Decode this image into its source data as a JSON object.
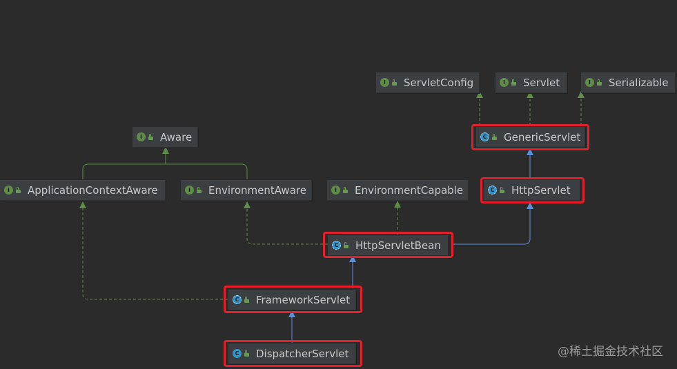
{
  "nodes": {
    "servlet_config": {
      "label": "ServletConfig",
      "kind": "interface",
      "badge": "I"
    },
    "servlet": {
      "label": "Servlet",
      "kind": "interface",
      "badge": "I"
    },
    "serializable": {
      "label": "Serializable",
      "kind": "interface",
      "badge": "I"
    },
    "generic_servlet": {
      "label": "GenericServlet",
      "kind": "abstract-class",
      "badge": "C"
    },
    "aware": {
      "label": "Aware",
      "kind": "interface",
      "badge": "I"
    },
    "application_context_aware": {
      "label": "ApplicationContextAware",
      "kind": "interface",
      "badge": "I"
    },
    "environment_aware": {
      "label": "EnvironmentAware",
      "kind": "interface",
      "badge": "I"
    },
    "environment_capable": {
      "label": "EnvironmentCapable",
      "kind": "interface",
      "badge": "I"
    },
    "http_servlet": {
      "label": "HttpServlet",
      "kind": "abstract-class",
      "badge": "C"
    },
    "http_servlet_bean": {
      "label": "HttpServletBean",
      "kind": "abstract-class",
      "badge": "C"
    },
    "framework_servlet": {
      "label": "FrameworkServlet",
      "kind": "abstract-class",
      "badge": "C"
    },
    "dispatcher_servlet": {
      "label": "DispatcherServlet",
      "kind": "class",
      "badge": "C"
    }
  },
  "edges": [
    {
      "from": "generic_servlet",
      "to": "servlet_config",
      "type": "implements"
    },
    {
      "from": "generic_servlet",
      "to": "servlet",
      "type": "implements"
    },
    {
      "from": "generic_servlet",
      "to": "serializable",
      "type": "implements"
    },
    {
      "from": "http_servlet",
      "to": "generic_servlet",
      "type": "extends"
    },
    {
      "from": "application_context_aware",
      "to": "aware",
      "type": "interface-extends"
    },
    {
      "from": "environment_aware",
      "to": "aware",
      "type": "interface-extends"
    },
    {
      "from": "http_servlet_bean",
      "to": "http_servlet",
      "type": "extends"
    },
    {
      "from": "http_servlet_bean",
      "to": "environment_capable",
      "type": "implements"
    },
    {
      "from": "http_servlet_bean",
      "to": "environment_aware",
      "type": "implements"
    },
    {
      "from": "framework_servlet",
      "to": "http_servlet_bean",
      "type": "extends"
    },
    {
      "from": "framework_servlet",
      "to": "application_context_aware",
      "type": "implements"
    },
    {
      "from": "dispatcher_servlet",
      "to": "framework_servlet",
      "type": "extends"
    }
  ],
  "highlighted": [
    "generic_servlet",
    "http_servlet",
    "http_servlet_bean",
    "framework_servlet",
    "dispatcher_servlet"
  ],
  "colors": {
    "background": "#2b2b2b",
    "node": "#3c3f41",
    "extends_edge": "#5b8fdc",
    "implements_edge": "#5f8c46",
    "highlight": "#e3202b",
    "interface_badge": "#5f8c46",
    "class_badge": "#3592c4"
  },
  "watermark": "@稀土掘金技术社区"
}
